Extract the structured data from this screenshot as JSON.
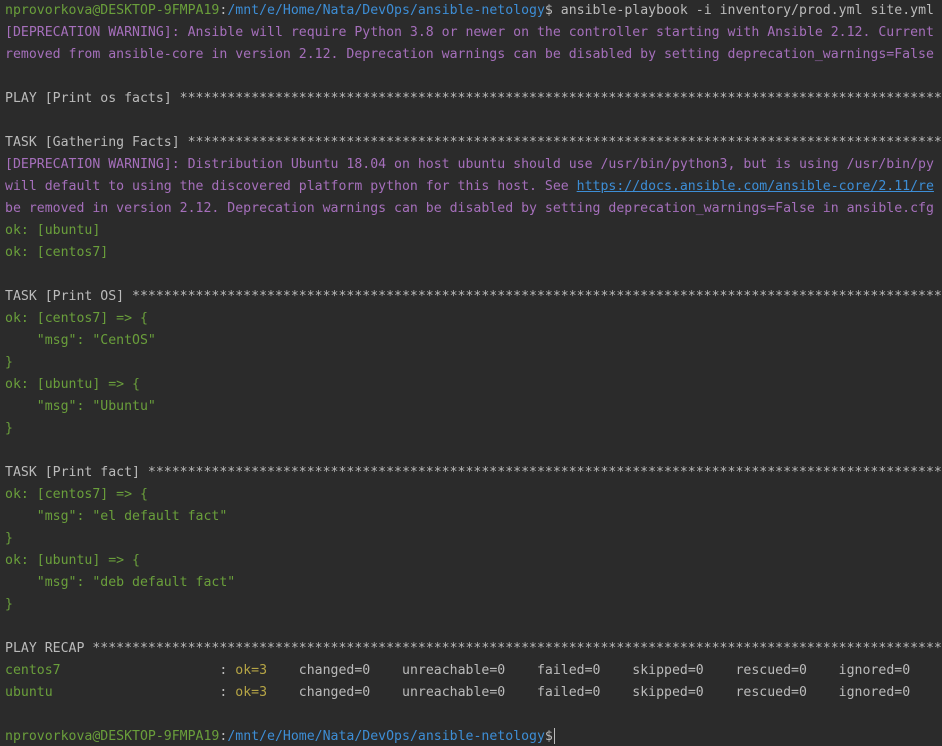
{
  "colors": {
    "background": "#2b2b2b",
    "default": "#bbbbbb",
    "prompt_user": "#6a9f3b",
    "prompt_path": "#3d8ed6",
    "ok": "#6a9f3b",
    "warning": "#a56fbb",
    "recap_ok": "#b6a545",
    "link": "#3d8ed6"
  },
  "lines": [
    {
      "segs": [
        {
          "t": "nprovorkova@DESKTOP-9FMPA19",
          "c": "green"
        },
        {
          "t": ":",
          "c": "white"
        },
        {
          "t": "/mnt/e/Home/Nata/DevOps/ansible-netology",
          "c": "blue"
        },
        {
          "t": "$ ansible-playbook -i inventory/prod.yml site.yml",
          "c": "white"
        }
      ]
    },
    {
      "segs": [
        {
          "t": "[DEPRECATION WARNING]: Ansible will require Python 3.8 or newer on the controller starting with Ansible 2.12. Current",
          "c": "purple"
        }
      ]
    },
    {
      "segs": [
        {
          "t": "removed from ansible-core in version 2.12. Deprecation warnings can be disabled by setting deprecation_warnings=False",
          "c": "purple"
        }
      ]
    },
    {
      "segs": []
    },
    {
      "segs": [
        {
          "t": "PLAY [Print os facts] ************************************************************************************************************",
          "c": "white"
        }
      ]
    },
    {
      "segs": []
    },
    {
      "segs": [
        {
          "t": "TASK [Gathering Facts] ***********************************************************************************************************",
          "c": "white"
        }
      ]
    },
    {
      "segs": [
        {
          "t": "[DEPRECATION WARNING]: Distribution Ubuntu 18.04 on host ubuntu should use /usr/bin/python3, but is using /usr/bin/py",
          "c": "purple"
        }
      ]
    },
    {
      "segs": [
        {
          "t": "will default to using the discovered platform python for this host. See ",
          "c": "purple"
        },
        {
          "t": "https://docs.ansible.com/ansible-core/2.11/re",
          "c": "link"
        }
      ]
    },
    {
      "segs": [
        {
          "t": "be removed in version 2.12. Deprecation warnings can be disabled by setting deprecation_warnings=False in ansible.cfg",
          "c": "purple"
        }
      ]
    },
    {
      "segs": [
        {
          "t": "ok: [ubuntu]",
          "c": "green"
        }
      ]
    },
    {
      "segs": [
        {
          "t": "ok: [centos7]",
          "c": "green"
        }
      ]
    },
    {
      "segs": []
    },
    {
      "segs": [
        {
          "t": "TASK [Print OS] ******************************************************************************************************************",
          "c": "white"
        }
      ]
    },
    {
      "segs": [
        {
          "t": "ok: [centos7] => {",
          "c": "green"
        }
      ]
    },
    {
      "segs": [
        {
          "t": "    \"msg\": \"CentOS\"",
          "c": "green"
        }
      ]
    },
    {
      "segs": [
        {
          "t": "}",
          "c": "green"
        }
      ]
    },
    {
      "segs": [
        {
          "t": "ok: [ubuntu] => {",
          "c": "green"
        }
      ]
    },
    {
      "segs": [
        {
          "t": "    \"msg\": \"Ubuntu\"",
          "c": "green"
        }
      ]
    },
    {
      "segs": [
        {
          "t": "}",
          "c": "green"
        }
      ]
    },
    {
      "segs": []
    },
    {
      "segs": [
        {
          "t": "TASK [Print fact] ****************************************************************************************************************",
          "c": "white"
        }
      ]
    },
    {
      "segs": [
        {
          "t": "ok: [centos7] => {",
          "c": "green"
        }
      ]
    },
    {
      "segs": [
        {
          "t": "    \"msg\": \"el default fact\"",
          "c": "green"
        }
      ]
    },
    {
      "segs": [
        {
          "t": "}",
          "c": "green"
        }
      ]
    },
    {
      "segs": [
        {
          "t": "ok: [ubuntu] => {",
          "c": "green"
        }
      ]
    },
    {
      "segs": [
        {
          "t": "    \"msg\": \"deb default fact\"",
          "c": "green"
        }
      ]
    },
    {
      "segs": [
        {
          "t": "}",
          "c": "green"
        }
      ]
    },
    {
      "segs": []
    },
    {
      "segs": [
        {
          "t": "PLAY RECAP ***********************************************************************************************************************",
          "c": "white"
        }
      ]
    },
    {
      "segs": [
        {
          "t": "centos7                    ",
          "c": "green"
        },
        {
          "t": ": ",
          "c": "white"
        },
        {
          "t": "ok=3",
          "c": "yellow"
        },
        {
          "t": "    changed=0    unreachable=0    failed=0    skipped=0    rescued=0    ignored=0",
          "c": "white"
        }
      ]
    },
    {
      "segs": [
        {
          "t": "ubuntu                     ",
          "c": "green"
        },
        {
          "t": ": ",
          "c": "white"
        },
        {
          "t": "ok=3",
          "c": "yellow"
        },
        {
          "t": "    changed=0    unreachable=0    failed=0    skipped=0    rescued=0    ignored=0",
          "c": "white"
        }
      ]
    },
    {
      "segs": []
    },
    {
      "segs": [
        {
          "t": "nprovorkova@DESKTOP-9FMPA19",
          "c": "green"
        },
        {
          "t": ":",
          "c": "white"
        },
        {
          "t": "/mnt/e/Home/Nata/DevOps/ansible-netology",
          "c": "blue"
        },
        {
          "t": "$",
          "c": "white"
        }
      ],
      "cursor": true
    }
  ]
}
